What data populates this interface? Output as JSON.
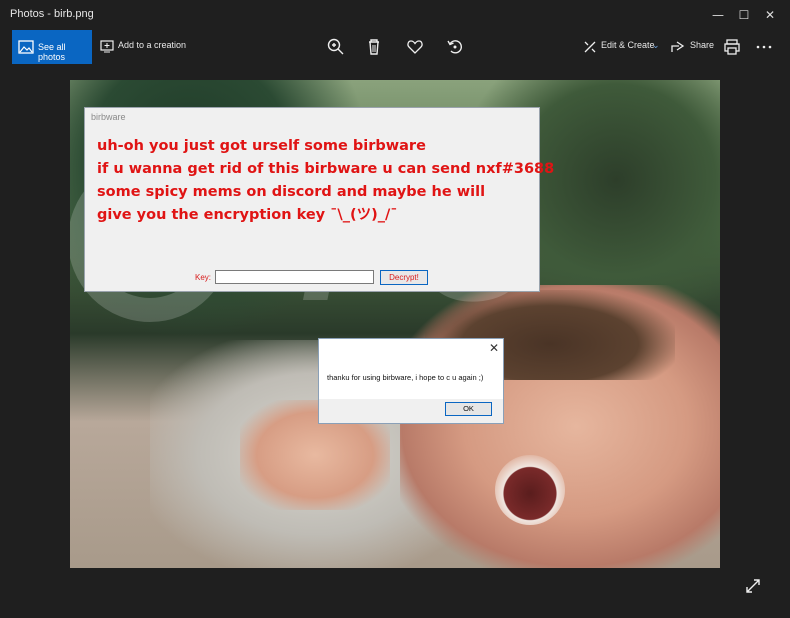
{
  "window": {
    "title": "Photos - birb.png",
    "minimize_glyph": "—",
    "maximize_glyph": "☐",
    "close_glyph": "✕"
  },
  "toolbar": {
    "see_all_label": "See all photos",
    "add_creation_label": "Add to a creation",
    "edit_create_label": "Edit & Create",
    "share_label": "Share",
    "icons": [
      "photos-icon",
      "add-to-creation-icon",
      "zoom-icon",
      "delete-icon",
      "favorite-icon",
      "rotate-icon",
      "edit-icon",
      "share-icon",
      "print-icon",
      "more-icon"
    ]
  },
  "birbware": {
    "caption": "birbware",
    "lines": [
      "uh-oh you just got urself some birbware",
      "if u wanna get rid of this birbware u can send nxf#3688",
      "some spicy mems on discord and maybe he will",
      "give you the encryption key ¯\\_(ツ)_/¯"
    ],
    "key_label": "Key:",
    "key_value": "",
    "decrypt_label": "Decrypt!",
    "text_color": "#e01414"
  },
  "msgbox": {
    "text": "thanku for using birbware, i hope to c u again ;)",
    "ok_label": "OK",
    "close_glyph": "✕"
  },
  "colors": {
    "accent": "#0a66c2",
    "background": "#1f1f1f"
  }
}
